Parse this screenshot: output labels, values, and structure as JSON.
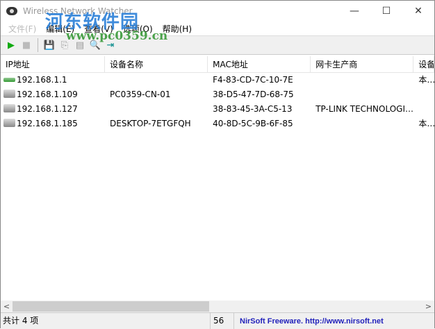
{
  "window": {
    "title": "Wireless Network Watcher",
    "minimize": "—",
    "maximize": "☐",
    "close": "✕"
  },
  "menu": [
    "文件(F)",
    "编辑(E)",
    "查看(V)",
    "选项(O)",
    "帮助(H)"
  ],
  "toolbar": {
    "start": "▶",
    "stop": "■",
    "save": "💾",
    "copy": "⎘",
    "report": "▤",
    "properties": "🔍",
    "exit": "⇥"
  },
  "columns": [
    "IP地址",
    "设备名称",
    "MAC地址",
    "网卡生产商",
    "设备信息"
  ],
  "rows": [
    {
      "icon": "router",
      "ip": "192.168.1.1",
      "name": "",
      "mac": "F4-83-CD-7C-10-7E",
      "vendor": "",
      "info": "本网关"
    },
    {
      "icon": "computer",
      "ip": "192.168.1.109",
      "name": "PC0359-CN-01",
      "mac": "38-D5-47-7D-68-75",
      "vendor": "",
      "info": ""
    },
    {
      "icon": "computer",
      "ip": "192.168.1.127",
      "name": "",
      "mac": "38-83-45-3A-C5-13",
      "vendor": "TP-LINK TECHNOLOGIES CO.,LTD.",
      "info": ""
    },
    {
      "icon": "computer",
      "ip": "192.168.1.185",
      "name": "DESKTOP-7ETGFQH",
      "mac": "40-8D-5C-9B-6F-85",
      "vendor": "",
      "info": "本机"
    }
  ],
  "scroll": {
    "left": "<",
    "right": ">",
    "position_fraction": 0
  },
  "status": {
    "count": "共计 4 项",
    "number": "56",
    "link": "NirSoft Freeware.  http://www.nirsoft.net"
  },
  "watermark": {
    "line1": "河东软件园",
    "line2": "www.pc0359.cn"
  }
}
